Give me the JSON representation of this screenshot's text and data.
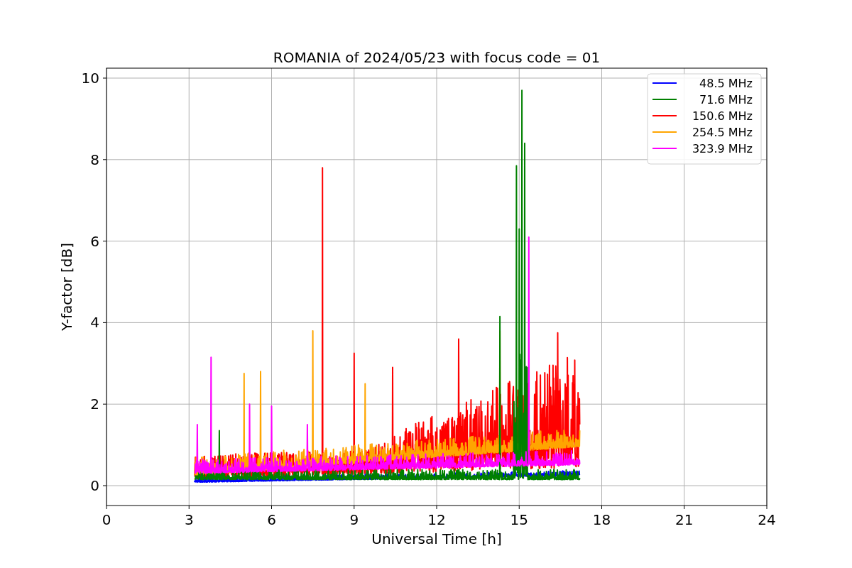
{
  "title": "ROMANIA of 2024/05/23 with focus code = 01",
  "x_axis": {
    "label": "Universal Time [h]",
    "ticks": [
      "0",
      "3",
      "6",
      "9",
      "12",
      "15",
      "18",
      "21",
      "24"
    ]
  },
  "y_axis": {
    "label": "Y-factor [dB]",
    "ticks": [
      "10",
      "8",
      "6",
      "4",
      "2",
      "0"
    ]
  },
  "legend": [
    {
      "label": "48.5 MHz",
      "color": "#0000ff"
    },
    {
      "label": "71.6 MHz",
      "color": "#008000"
    },
    {
      "label": "150.6 MHz",
      "color": "#ff0000"
    },
    {
      "label": "254.5 MHz",
      "color": "#ffa500"
    },
    {
      "label": "323.9 MHz",
      "color": "#ff00ff"
    }
  ]
}
